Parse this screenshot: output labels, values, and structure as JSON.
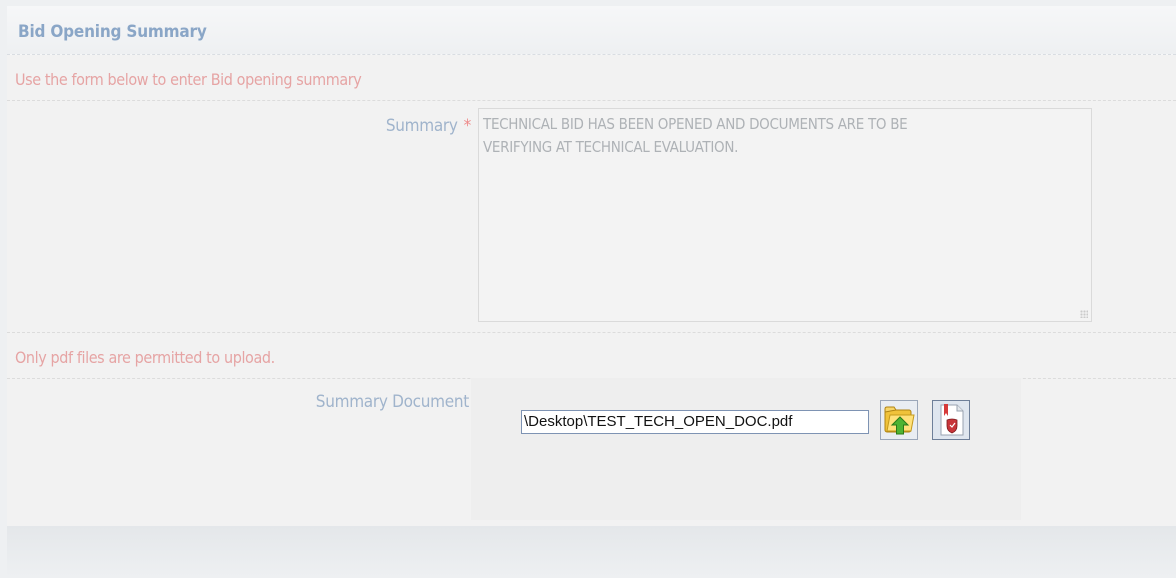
{
  "panel": {
    "title": "Bid Opening Summary",
    "instruction": "Use the form below to enter Bid opening summary",
    "upload_note": "Only pdf files are permitted to upload."
  },
  "summary": {
    "label": "Summary",
    "required_mark": "*",
    "value_line1": "TECHNICAL BID HAS BEEN OPENED AND DOCUMENTS ARE TO BE",
    "value_line2": "VERIFYING AT TECHNICAL EVALUATION."
  },
  "summary_document": {
    "label": "Summary Document",
    "file_path": "\\Desktop\\TEST_TECH_OPEN_DOC.pdf",
    "browse_icon": "folder-upload-icon",
    "view_icon": "pdf-document-icon"
  },
  "colors": {
    "title": "#8aa6c7",
    "note": "#e6a4a4",
    "label": "#a0b4cc",
    "required": "#ee8a8a"
  }
}
